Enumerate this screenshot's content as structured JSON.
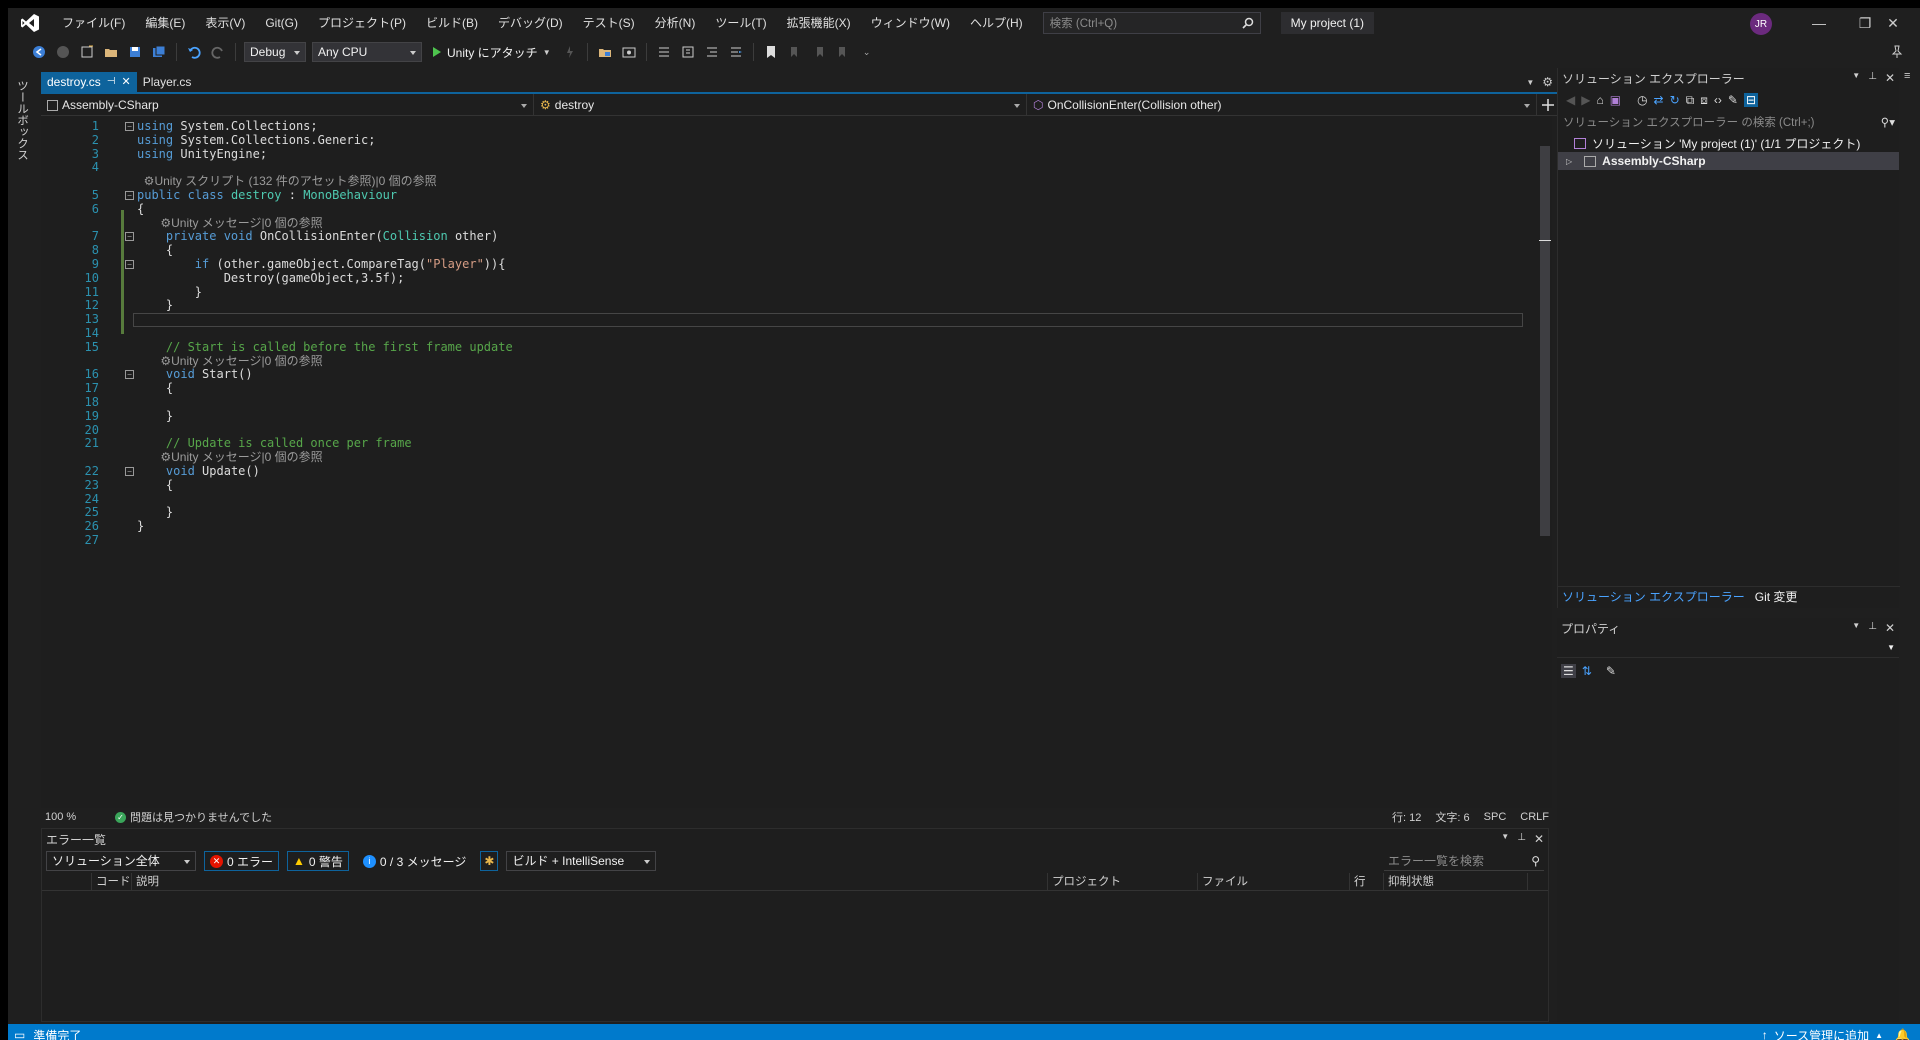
{
  "app": {
    "menu": [
      "ファイル(F)",
      "編集(E)",
      "表示(V)",
      "Git(G)",
      "プロジェクト(P)",
      "ビルド(B)",
      "デバッグ(D)",
      "テスト(S)",
      "分析(N)",
      "ツール(T)",
      "拡張機能(X)",
      "ウィンドウ(W)",
      "ヘルプ(H)"
    ],
    "search_placeholder": "検索 (Ctrl+Q)",
    "project_name": "My project (1)",
    "avatar_initials": "JR"
  },
  "toolbar": {
    "config": "Debug",
    "platform": "Any CPU",
    "attach_label": "Unity にアタッチ"
  },
  "left_strip": {
    "toolbox_label": "ツールボックス"
  },
  "tabs": [
    {
      "label": "destroy.cs",
      "active": true
    },
    {
      "label": "Player.cs",
      "active": false
    }
  ],
  "navbar": {
    "project": "Assembly-CSharp",
    "class": "destroy",
    "member": "OnCollisionEnter(Collision other)"
  },
  "code": {
    "using1": "System.Collections;",
    "using2": "System.Collections.Generic;",
    "using3": "UnityEngine;",
    "lens_class": "Unity スクリプト (132 件のアセット参照)|0 個の参照",
    "lens_msg": "Unity メッセージ|0 個の参照",
    "class_name": "destroy",
    "base_class": "MonoBehaviour",
    "method1": "OnCollisionEnter",
    "param_type": "Collision",
    "param_name": "other",
    "if_expr": "(other.gameObject.CompareTag(",
    "tag": "\"Player\"",
    "destroy_call": "Destroy(gameObject,3.5f);",
    "comment_start": "// Start is called before the first frame update",
    "comment_update": "// Update is called once per frame",
    "start_name": "Start",
    "update_name": "Update"
  },
  "editor_status": {
    "zoom": "100 %",
    "issues": "問題は見つかりませんでした",
    "line": "行: 12",
    "col": "文字: 6",
    "spc": "SPC",
    "crlf": "CRLF"
  },
  "error_list": {
    "title": "エラー一覧",
    "scope": "ソリューション全体",
    "errors": "0 エラー",
    "warnings": "0 警告",
    "messages": "0 / 3 メッセージ",
    "build_filter": "ビルド + IntelliSense",
    "search_placeholder": "エラー一覧を検索",
    "columns": [
      "コード",
      "説明",
      "プロジェクト",
      "ファイル",
      "行",
      "抑制状態"
    ]
  },
  "solution_explorer": {
    "title": "ソリューション エクスプローラー",
    "search_placeholder": "ソリューション エクスプローラー の検索 (Ctrl+;)",
    "solution_label": "ソリューション 'My project (1)' (1/1 プロジェクト)",
    "project_label": "Assembly-CSharp",
    "tab_se": "ソリューション エクスプローラー",
    "tab_git": "Git 変更"
  },
  "properties": {
    "title": "プロパティ"
  },
  "statusbar": {
    "ready": "準備完了",
    "source_control": "ソース管理に追加"
  },
  "colors": {
    "accent": "#007acc",
    "keyword": "#569cd6",
    "type": "#4ec9b0",
    "string": "#d69d85",
    "comment": "#57a64a"
  }
}
